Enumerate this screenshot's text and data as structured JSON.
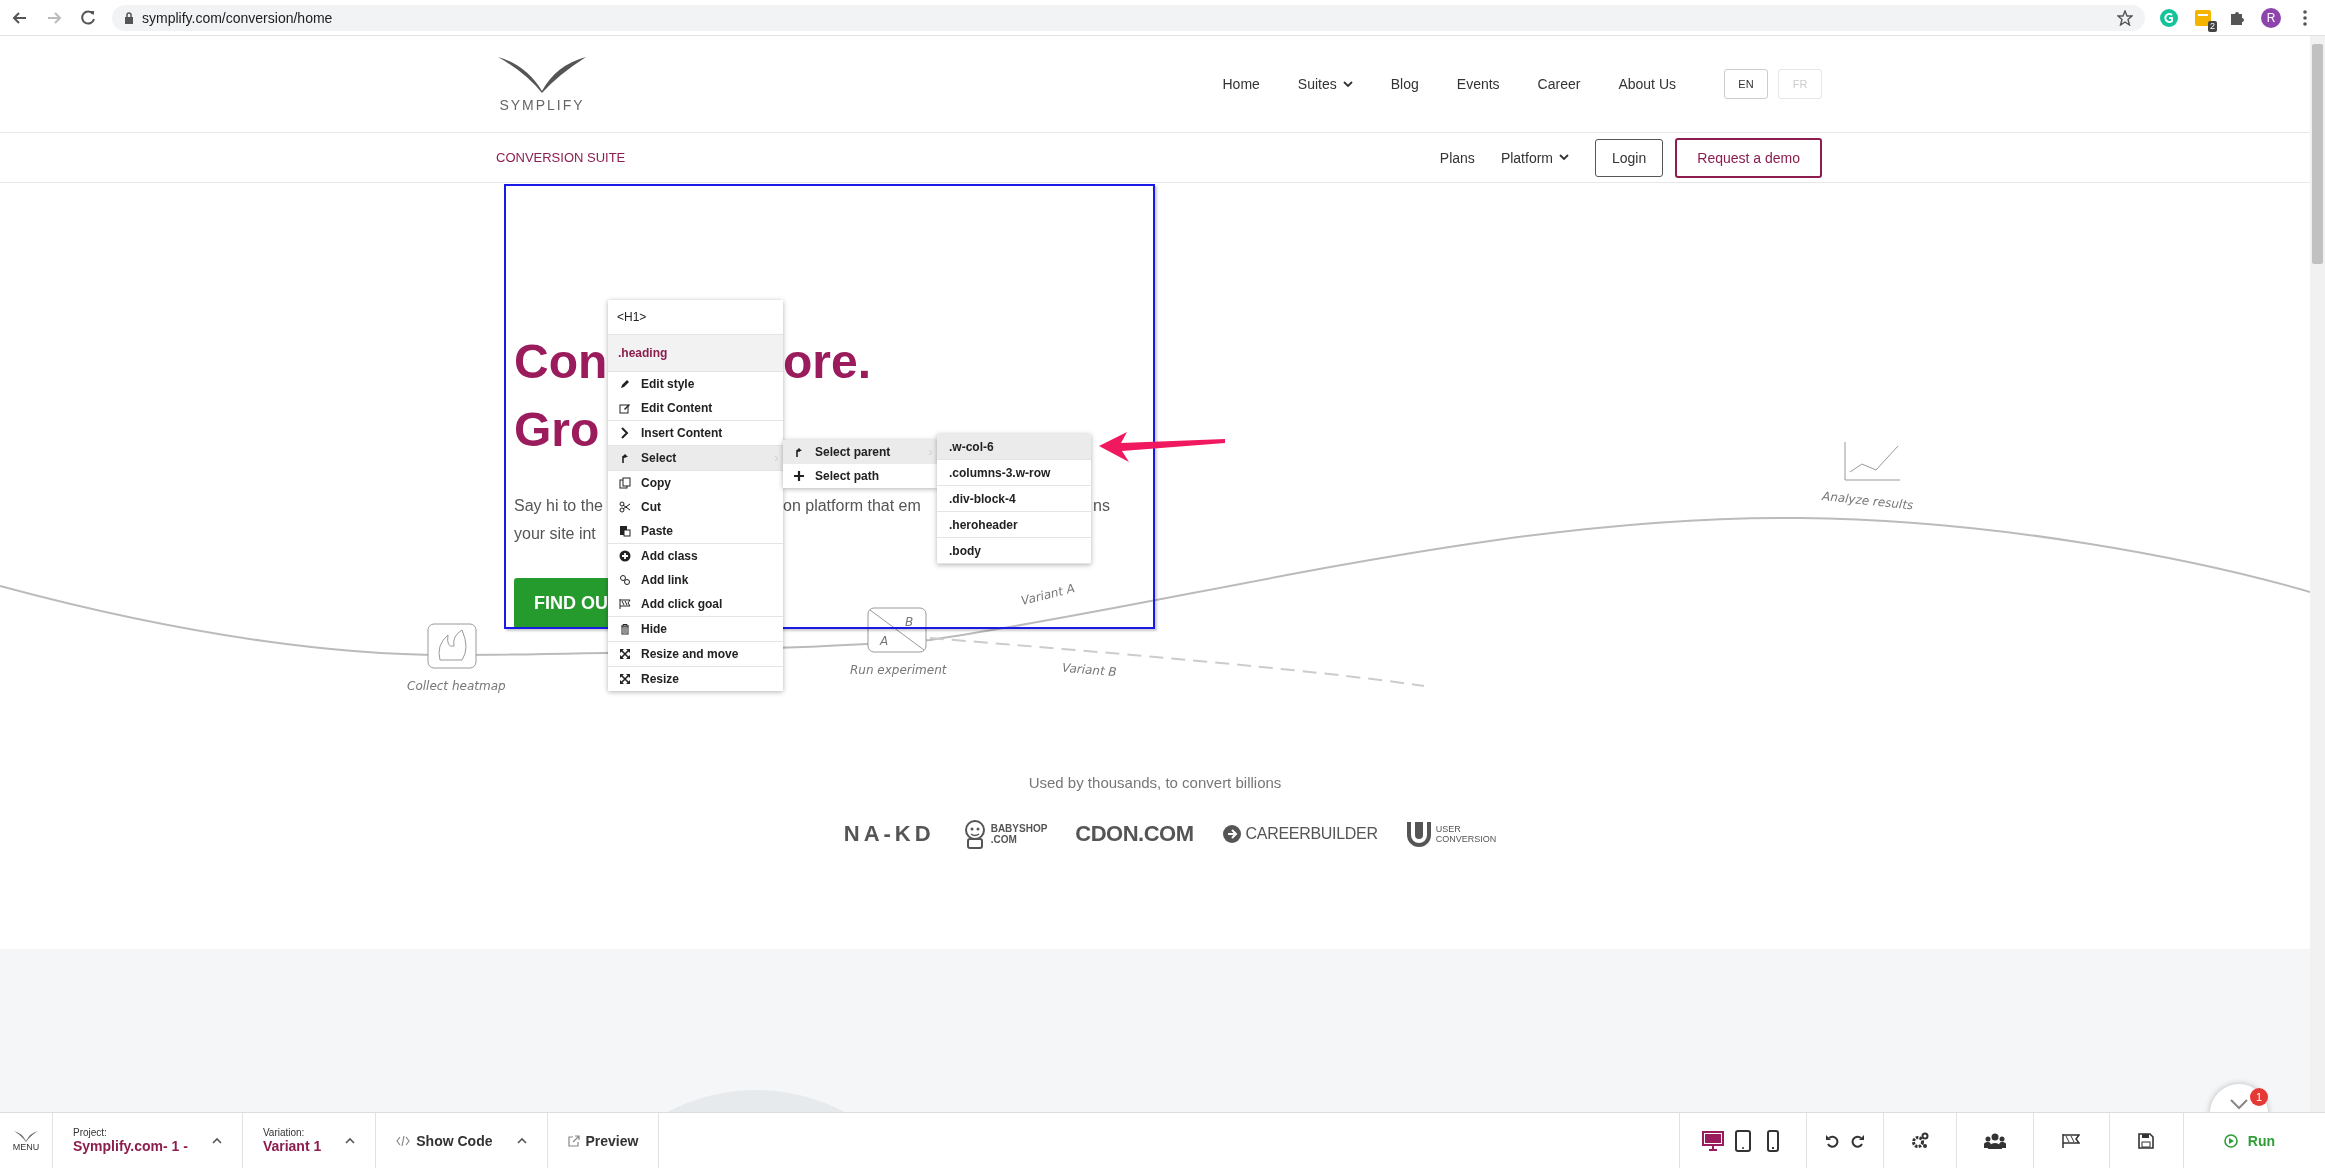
{
  "browser": {
    "url": "symplify.com/conversion/home",
    "forward_disabled": true,
    "extension_badge": "2",
    "avatar_letter": "R"
  },
  "header": {
    "logo_text": "SYMPLIFY",
    "nav": [
      {
        "label": "Home",
        "dropdown": false
      },
      {
        "label": "Suites",
        "dropdown": true
      },
      {
        "label": "Blog",
        "dropdown": false
      },
      {
        "label": "Events",
        "dropdown": false
      },
      {
        "label": "Career",
        "dropdown": false
      },
      {
        "label": "About Us",
        "dropdown": false
      }
    ],
    "languages": [
      {
        "label": "EN",
        "disabled": false
      },
      {
        "label": "FR",
        "disabled": true
      }
    ]
  },
  "subheader": {
    "title": "CONVERSION SUITE",
    "links": [
      {
        "label": "Plans",
        "dropdown": false
      },
      {
        "label": "Platform",
        "dropdown": true
      }
    ],
    "login": "Login",
    "demo": "Request a demo"
  },
  "hero": {
    "heading_lines": [
      [
        "Con",
        "ore."
      ],
      [
        "Gro"
      ]
    ],
    "paragraph_lines": [
      [
        "Say hi to the",
        "on platform that em",
        "ns"
      ],
      [
        "your site int"
      ]
    ],
    "button": "FIND OU"
  },
  "sketch": {
    "ab_letters": [
      "A",
      "B"
    ],
    "heatmap_label": "Collect heatmap",
    "experiment_label": "Run experiment",
    "variant_a": "Variant A",
    "variant_b": "Variant B",
    "results_label": "Analyze results"
  },
  "context_menu": {
    "tag": "<H1>",
    "class_name": ".heading",
    "groups": [
      [
        {
          "label": "Edit style",
          "kind": "pencil",
          "selected": false
        },
        {
          "label": "Edit Content",
          "kind": "edit",
          "selected": false
        }
      ],
      [
        {
          "label": "Insert Content",
          "kind": "chevron",
          "selected": false
        }
      ],
      [
        {
          "label": "Select",
          "kind": "select",
          "selected": true
        }
      ],
      [
        {
          "label": "Copy",
          "kind": "copy",
          "selected": false
        },
        {
          "label": "Cut",
          "kind": "cut",
          "selected": false
        },
        {
          "label": "Paste",
          "kind": "paste",
          "selected": false
        }
      ],
      [
        {
          "label": "Add class",
          "kind": "plus-circle",
          "selected": false
        },
        {
          "label": "Add link",
          "kind": "link",
          "selected": false
        },
        {
          "label": "Add click goal",
          "kind": "flag",
          "selected": false
        }
      ],
      [
        {
          "label": "Hide",
          "kind": "trash",
          "selected": false
        }
      ],
      [
        {
          "label": "Resize and move",
          "kind": "resize",
          "selected": false
        }
      ],
      [
        {
          "label": "Resize",
          "kind": "resize",
          "selected": false
        }
      ]
    ]
  },
  "select_menu": {
    "items": [
      {
        "label": "Select parent",
        "kind": "select",
        "selected": true
      },
      {
        "label": "Select path",
        "kind": "plus",
        "selected": false
      }
    ]
  },
  "parent_menu": {
    "items": [
      {
        "label": ".w-col-6",
        "selected": true
      },
      {
        "label": ".columns-3.w-row",
        "selected": false
      },
      {
        "label": ".div-block-4",
        "selected": false
      },
      {
        "label": ".heroheader",
        "selected": false
      },
      {
        "label": ".body",
        "selected": false
      }
    ]
  },
  "trust": {
    "caption": "Used by thousands, to convert billions",
    "logos": [
      {
        "kind": "nakd",
        "lines": [
          "NA-KD"
        ]
      },
      {
        "kind": "babyshop",
        "lines": [
          "BABYSHOP",
          ".COM"
        ]
      },
      {
        "kind": "cdon",
        "lines": [
          "CDON.COM"
        ]
      },
      {
        "kind": "careerbuilder",
        "lines": [
          "CAREERBUILDER"
        ]
      },
      {
        "kind": "userconversion",
        "lines": [
          "USER",
          "CONVERSION"
        ]
      }
    ]
  },
  "chat": {
    "badge": "1"
  },
  "toolbar": {
    "menu_label": "MENU",
    "project_label": "Project:",
    "project": "Symplify.com- 1 -",
    "variation_label": "Variation:",
    "variation": "Variant 1",
    "show_code": "Show Code",
    "preview": "Preview",
    "devices": [
      {
        "kind": "desktop",
        "selected": true
      },
      {
        "kind": "tablet",
        "selected": false
      },
      {
        "kind": "phone",
        "selected": false
      }
    ],
    "run": "Run"
  }
}
